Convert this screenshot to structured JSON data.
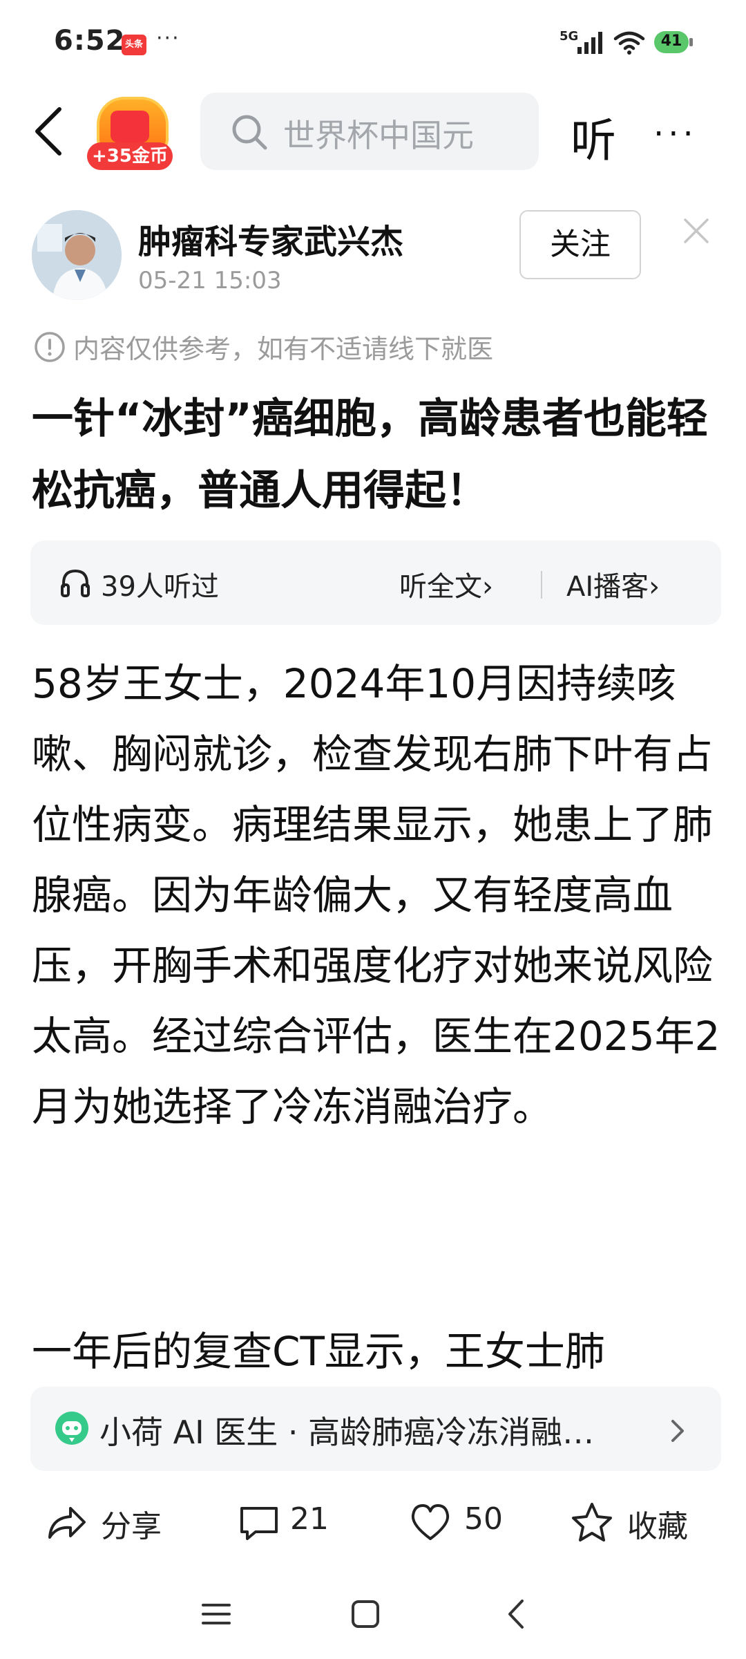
{
  "status_bar": {
    "time": "6:52",
    "notif_badge": "头条",
    "more": "···",
    "network": "5G",
    "battery": "41"
  },
  "top_bar": {
    "coin_label": "+35金币",
    "search_placeholder": "世界杯中国元",
    "listen": "听",
    "more": "···"
  },
  "author": {
    "name": "肿瘤科专家武兴杰",
    "time": "05-21 15:03",
    "follow": "关注"
  },
  "disclaimer": "内容仅供参考，如有不适请线下就医",
  "article": {
    "title": "一针“冰封”癌细胞，高龄患者也能轻松抗癌，普通人用得起！",
    "paragraphs": [
      "58岁王女士，2024年10月因持续咳嗽、胸闷就诊，检查发现右肺下叶有占位性病变。病理结果显示，她患上了肺腺癌。因为年龄偏大，又有轻度高血压，开胸手术和强度化疗对她来说风险太高。经过综合评估，医生在2025年2月为她选择了冷冻消融治疗。",
      "一年后的复查CT显示，王女士肺"
    ]
  },
  "listen_card": {
    "listeners": "39人听过",
    "full_text": "听全文›",
    "ai_podcast": "AI播客›"
  },
  "ai_doctor": {
    "text": "小荷 AI 医生 · 高龄肺癌冷冻消融…"
  },
  "actions": {
    "share": "分享",
    "comments": "21",
    "likes": "50",
    "favorite": "收藏"
  },
  "colors": {
    "accent_red": "#f23a3a",
    "coin_orange": "#ff8a1a",
    "battery_green": "#5ac86a",
    "ai_green": "#35c98a"
  }
}
